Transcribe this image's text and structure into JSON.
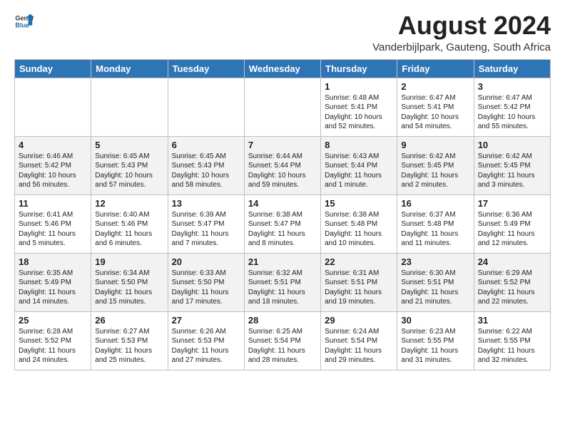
{
  "header": {
    "logo_general": "General",
    "logo_blue": "Blue",
    "month_year": "August 2024",
    "location": "Vanderbijlpark, Gauteng, South Africa"
  },
  "days_of_week": [
    "Sunday",
    "Monday",
    "Tuesday",
    "Wednesday",
    "Thursday",
    "Friday",
    "Saturday"
  ],
  "weeks": [
    [
      {
        "day": "",
        "content": ""
      },
      {
        "day": "",
        "content": ""
      },
      {
        "day": "",
        "content": ""
      },
      {
        "day": "",
        "content": ""
      },
      {
        "day": "1",
        "content": "Sunrise: 6:48 AM\nSunset: 5:41 PM\nDaylight: 10 hours and 52 minutes."
      },
      {
        "day": "2",
        "content": "Sunrise: 6:47 AM\nSunset: 5:41 PM\nDaylight: 10 hours and 54 minutes."
      },
      {
        "day": "3",
        "content": "Sunrise: 6:47 AM\nSunset: 5:42 PM\nDaylight: 10 hours and 55 minutes."
      }
    ],
    [
      {
        "day": "4",
        "content": "Sunrise: 6:46 AM\nSunset: 5:42 PM\nDaylight: 10 hours and 56 minutes."
      },
      {
        "day": "5",
        "content": "Sunrise: 6:45 AM\nSunset: 5:43 PM\nDaylight: 10 hours and 57 minutes."
      },
      {
        "day": "6",
        "content": "Sunrise: 6:45 AM\nSunset: 5:43 PM\nDaylight: 10 hours and 58 minutes."
      },
      {
        "day": "7",
        "content": "Sunrise: 6:44 AM\nSunset: 5:44 PM\nDaylight: 10 hours and 59 minutes."
      },
      {
        "day": "8",
        "content": "Sunrise: 6:43 AM\nSunset: 5:44 PM\nDaylight: 11 hours and 1 minute."
      },
      {
        "day": "9",
        "content": "Sunrise: 6:42 AM\nSunset: 5:45 PM\nDaylight: 11 hours and 2 minutes."
      },
      {
        "day": "10",
        "content": "Sunrise: 6:42 AM\nSunset: 5:45 PM\nDaylight: 11 hours and 3 minutes."
      }
    ],
    [
      {
        "day": "11",
        "content": "Sunrise: 6:41 AM\nSunset: 5:46 PM\nDaylight: 11 hours and 5 minutes."
      },
      {
        "day": "12",
        "content": "Sunrise: 6:40 AM\nSunset: 5:46 PM\nDaylight: 11 hours and 6 minutes."
      },
      {
        "day": "13",
        "content": "Sunrise: 6:39 AM\nSunset: 5:47 PM\nDaylight: 11 hours and 7 minutes."
      },
      {
        "day": "14",
        "content": "Sunrise: 6:38 AM\nSunset: 5:47 PM\nDaylight: 11 hours and 8 minutes."
      },
      {
        "day": "15",
        "content": "Sunrise: 6:38 AM\nSunset: 5:48 PM\nDaylight: 11 hours and 10 minutes."
      },
      {
        "day": "16",
        "content": "Sunrise: 6:37 AM\nSunset: 5:48 PM\nDaylight: 11 hours and 11 minutes."
      },
      {
        "day": "17",
        "content": "Sunrise: 6:36 AM\nSunset: 5:49 PM\nDaylight: 11 hours and 12 minutes."
      }
    ],
    [
      {
        "day": "18",
        "content": "Sunrise: 6:35 AM\nSunset: 5:49 PM\nDaylight: 11 hours and 14 minutes."
      },
      {
        "day": "19",
        "content": "Sunrise: 6:34 AM\nSunset: 5:50 PM\nDaylight: 11 hours and 15 minutes."
      },
      {
        "day": "20",
        "content": "Sunrise: 6:33 AM\nSunset: 5:50 PM\nDaylight: 11 hours and 17 minutes."
      },
      {
        "day": "21",
        "content": "Sunrise: 6:32 AM\nSunset: 5:51 PM\nDaylight: 11 hours and 18 minutes."
      },
      {
        "day": "22",
        "content": "Sunrise: 6:31 AM\nSunset: 5:51 PM\nDaylight: 11 hours and 19 minutes."
      },
      {
        "day": "23",
        "content": "Sunrise: 6:30 AM\nSunset: 5:51 PM\nDaylight: 11 hours and 21 minutes."
      },
      {
        "day": "24",
        "content": "Sunrise: 6:29 AM\nSunset: 5:52 PM\nDaylight: 11 hours and 22 minutes."
      }
    ],
    [
      {
        "day": "25",
        "content": "Sunrise: 6:28 AM\nSunset: 5:52 PM\nDaylight: 11 hours and 24 minutes."
      },
      {
        "day": "26",
        "content": "Sunrise: 6:27 AM\nSunset: 5:53 PM\nDaylight: 11 hours and 25 minutes."
      },
      {
        "day": "27",
        "content": "Sunrise: 6:26 AM\nSunset: 5:53 PM\nDaylight: 11 hours and 27 minutes."
      },
      {
        "day": "28",
        "content": "Sunrise: 6:25 AM\nSunset: 5:54 PM\nDaylight: 11 hours and 28 minutes."
      },
      {
        "day": "29",
        "content": "Sunrise: 6:24 AM\nSunset: 5:54 PM\nDaylight: 11 hours and 29 minutes."
      },
      {
        "day": "30",
        "content": "Sunrise: 6:23 AM\nSunset: 5:55 PM\nDaylight: 11 hours and 31 minutes."
      },
      {
        "day": "31",
        "content": "Sunrise: 6:22 AM\nSunset: 5:55 PM\nDaylight: 11 hours and 32 minutes."
      }
    ]
  ]
}
